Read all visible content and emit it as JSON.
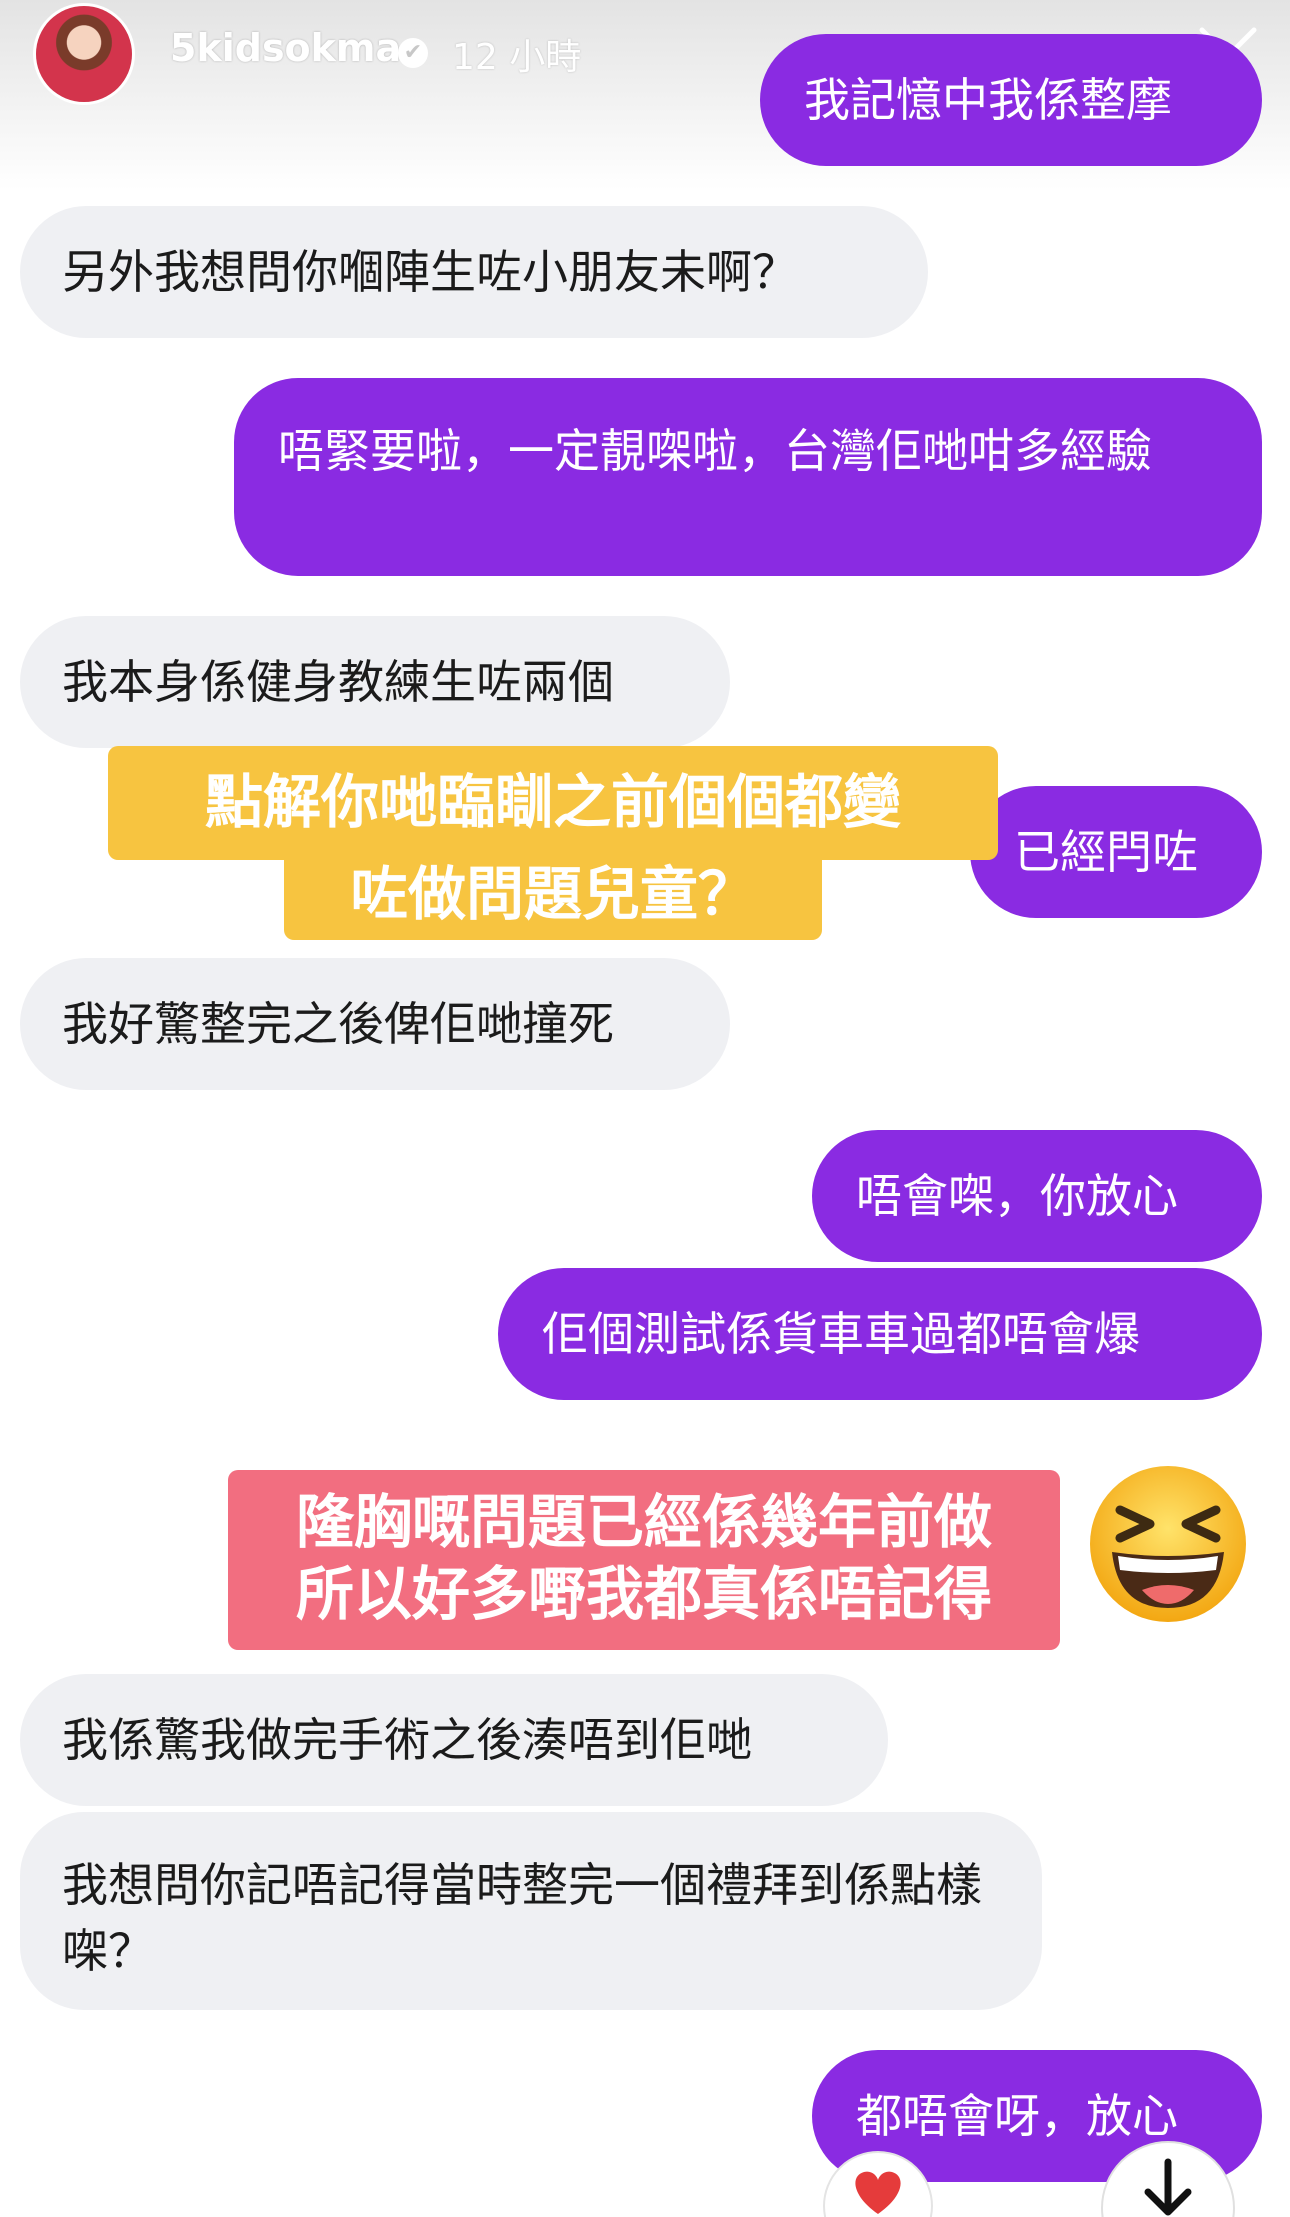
{
  "story_header": {
    "username": "5kidsokma",
    "verified_badge": "✔",
    "time_ago": "12 小時",
    "more_icon": "more-horizontal-icon",
    "close_icon": "close-icon"
  },
  "messages": [
    {
      "side": "outgoing",
      "text": "我記憶中我係整摩"
    },
    {
      "side": "incoming",
      "text": "另外我想問你嗰陣生咗小朋友未啊？"
    },
    {
      "side": "outgoing",
      "text": "唔緊要啦，一定靚㗎啦，台灣佢哋咁多經驗"
    },
    {
      "side": "incoming",
      "text": "我本身係健身教練生咗兩個"
    },
    {
      "side": "outgoing",
      "text": "已經閂咗"
    },
    {
      "side": "incoming",
      "text": "我好驚整完之後俾佢哋撞死"
    },
    {
      "side": "outgoing",
      "text": "唔會㗎，你放心"
    },
    {
      "side": "outgoing",
      "text": "佢個測試係貨車車過都唔會爆"
    },
    {
      "side": "incoming",
      "text": "我係驚我做完手術之後湊唔到佢哋"
    },
    {
      "side": "incoming",
      "text": "我想問你記唔記得當時整完一個禮拜到係點樣㗎？"
    },
    {
      "side": "outgoing",
      "text": "都唔會呀，放心"
    }
  ],
  "stickers": {
    "yellow": {
      "line1": "點解你哋臨瞓之前個個都變",
      "line2": "咗做問題兒童？",
      "color": "#f7c440"
    },
    "pink": {
      "line1": "隆胸嘅問題已經係幾年前做",
      "line2": "所以好多嘢我都真係唔記得",
      "color": "#f26e80"
    }
  },
  "icons": {
    "emoji": "grinning-squinting-face-icon",
    "reaction": "heart-icon",
    "scroll": "arrow-down-icon"
  },
  "colors": {
    "outgoing_bubble": "#8a2be2",
    "incoming_bubble": "#eff0f3"
  }
}
